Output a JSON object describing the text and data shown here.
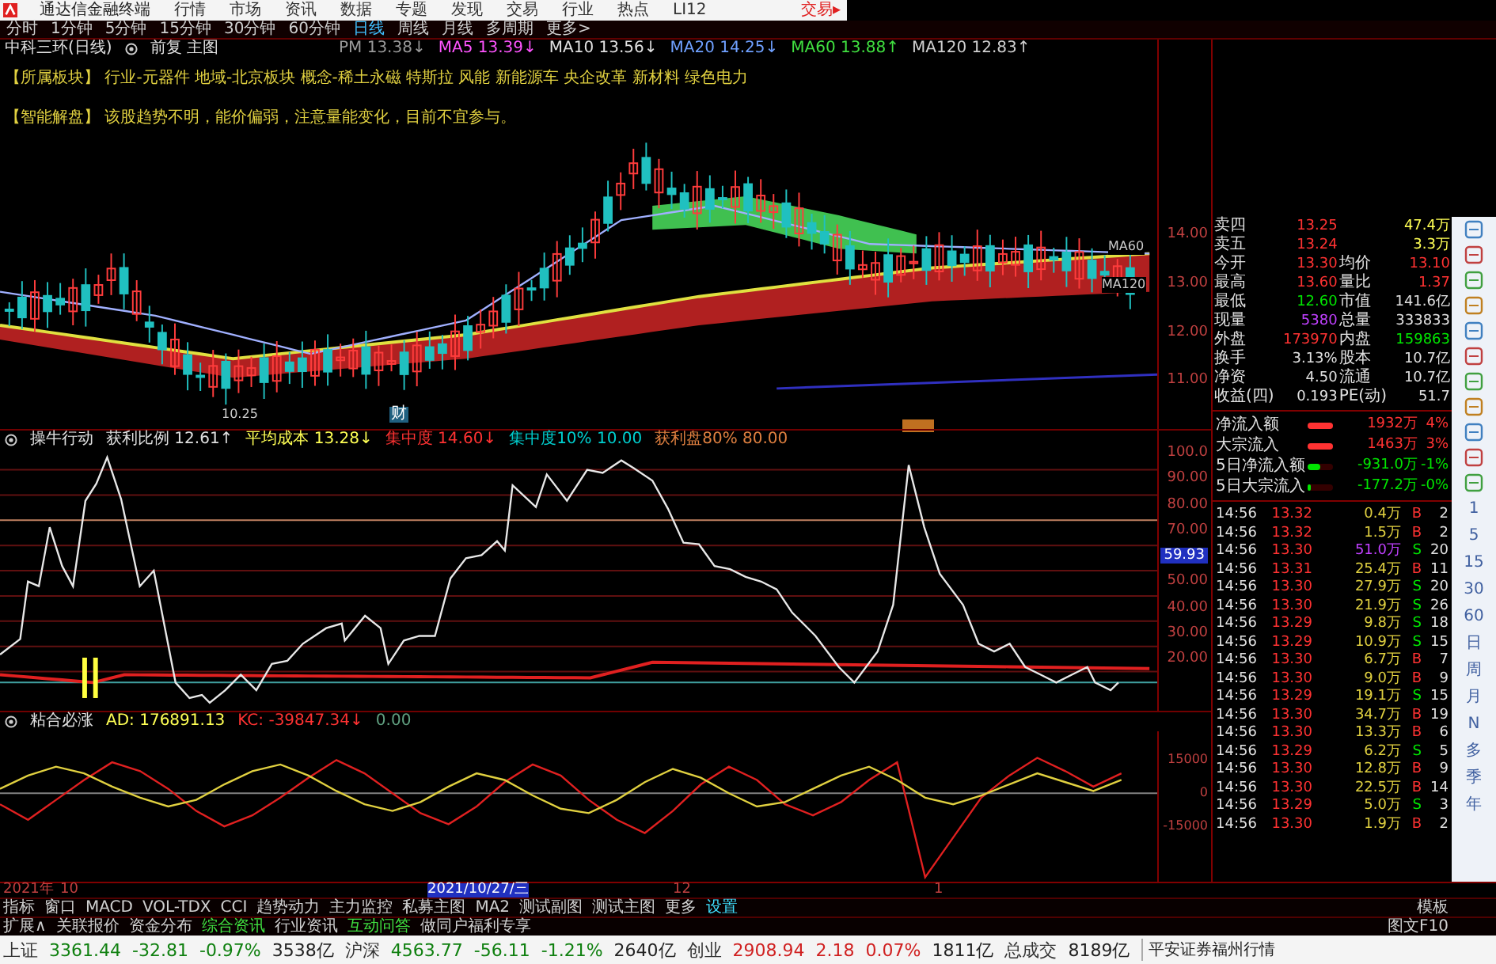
{
  "menu": {
    "app_title": "通达信金融终端",
    "items": [
      "行情",
      "市场",
      "资讯",
      "数据",
      "专题",
      "发现",
      "交易",
      "行业",
      "热点",
      "LI12"
    ],
    "trade_button": "交易▸"
  },
  "periods": [
    {
      "label": "分时",
      "selected": false
    },
    {
      "label": "1分钟",
      "selected": false
    },
    {
      "label": "5分钟",
      "selected": false
    },
    {
      "label": "15分钟",
      "selected": false
    },
    {
      "label": "30分钟",
      "selected": false
    },
    {
      "label": "60分钟",
      "selected": false
    },
    {
      "label": "日线",
      "selected": true
    },
    {
      "label": "周线",
      "selected": false
    },
    {
      "label": "月线",
      "selected": false
    },
    {
      "label": "多周期",
      "selected": false
    },
    {
      "label": "更多>",
      "selected": false
    }
  ],
  "main_chart": {
    "stock_name": "中科三环(日线)",
    "mode": "前复 主图",
    "indicators": [
      {
        "text": "PM 13.38↓",
        "color": "#9a9a9a"
      },
      {
        "text": "MA5 13.39↓",
        "color": "#ff54ff"
      },
      {
        "text": "MA10 13.56↓",
        "color": "#e0e0e0"
      },
      {
        "text": "MA20 14.25↓",
        "color": "#6fa0ff"
      },
      {
        "text": "MA60 13.88↑",
        "color": "#40e040"
      },
      {
        "text": "MA120 12.83↑",
        "color": "#d0d0d0"
      }
    ],
    "sector": {
      "label": "【所属板块】",
      "text": "行业-元器件  地域-北京板块  概念-稀土永磁 特斯拉 风能 新能源车 央企改革 新材料 绿色电力"
    },
    "analysis": {
      "label": "【智能解盘】",
      "text": "该股趋势不明，能价偏弱，注意量能变化，目前不宜参与。"
    },
    "line_labels": [
      "MA60",
      "MA120"
    ],
    "low_label": "10.25",
    "marker": "财",
    "y_labels": [
      "14.00",
      "13.00",
      "12.00",
      "11.00"
    ]
  },
  "chip_indicator": {
    "name": "操牛行动",
    "items": [
      {
        "text": "获利比例 12.61↑",
        "color": "#e0e0e0"
      },
      {
        "text": "平均成本 13.28↓",
        "color": "#ffff54"
      },
      {
        "text": "集中度 14.60↓",
        "color": "#ff3232"
      },
      {
        "text": "集中度10% 10.00",
        "color": "#00d0d0"
      },
      {
        "text": "获利盘80% 80.00",
        "color": "#e08040"
      }
    ],
    "y_labels": [
      {
        "text": "100.0",
        "current": false
      },
      {
        "text": "90.00",
        "current": false
      },
      {
        "text": "80.00",
        "current": false
      },
      {
        "text": "70.00",
        "current": false
      },
      {
        "text": "59.93",
        "current": true
      },
      {
        "text": "50.00",
        "current": false
      },
      {
        "text": "40.00",
        "current": false
      },
      {
        "text": "30.00",
        "current": false
      },
      {
        "text": "20.00",
        "current": false
      }
    ]
  },
  "oscillator": {
    "name": "粘合必涨",
    "items": [
      {
        "text": "AD: 176891.13",
        "color": "#ffff54"
      },
      {
        "text": "KC: -39847.34↓",
        "color": "#ff3232"
      },
      {
        "text": "0.00",
        "color": "#60a080"
      }
    ],
    "chart_data": {
      "type": "line",
      "ylim": [
        -40000,
        28000
      ],
      "yticks": [
        15000,
        0,
        -15000
      ],
      "series": [
        {
          "color": "#e0d040",
          "values": [
            2000,
            8000,
            12000,
            9000,
            3000,
            -2000,
            -6000,
            -3000,
            4000,
            10000,
            13000,
            8000,
            1000,
            -5000,
            -8000,
            -4000,
            3000,
            9000,
            6000,
            -1000,
            -7000,
            -9000,
            -3000,
            5000,
            11000,
            7000,
            0,
            -6000,
            -4000,
            2000,
            8000,
            12000,
            6000,
            -2000,
            -5000,
            -1000,
            4000,
            9000,
            5000,
            1000,
            6000
          ]
        },
        {
          "color": "#e02020",
          "values": [
            -5000,
            -12000,
            -3000,
            6000,
            14000,
            10000,
            2000,
            -8000,
            -15000,
            -10000,
            -2000,
            7000,
            15000,
            9000,
            0,
            -9000,
            -14000,
            -6000,
            5000,
            13000,
            8000,
            -3000,
            -12000,
            -18000,
            -8000,
            4000,
            12000,
            6000,
            -5000,
            -10000,
            -4000,
            6000,
            14000,
            -38000,
            -20000,
            -2000,
            8000,
            16000,
            10000,
            3000,
            9000
          ]
        }
      ]
    }
  },
  "date_axis": [
    {
      "label": "2021年",
      "selected": false
    },
    {
      "label": "10",
      "selected": false
    },
    {
      "label": "2021/10/27/三",
      "selected": true
    },
    {
      "label": "12",
      "selected": false
    },
    {
      "label": "1",
      "selected": false
    }
  ],
  "indicator_tabs": [
    {
      "label": "指标",
      "selected": false
    },
    {
      "label": "窗口",
      "selected": false
    },
    {
      "label": "MACD",
      "selected": false
    },
    {
      "label": "VOL-TDX",
      "selected": false
    },
    {
      "label": "CCI",
      "selected": false
    },
    {
      "label": "趋势动力",
      "selected": false
    },
    {
      "label": "主力监控",
      "selected": false
    },
    {
      "label": "私募主图",
      "selected": false
    },
    {
      "label": "MA2",
      "selected": false
    },
    {
      "label": "测试副图",
      "selected": false
    },
    {
      "label": "测试主图",
      "selected": false
    },
    {
      "label": "更多",
      "selected": false
    },
    {
      "label": "设置",
      "selected": true
    }
  ],
  "template_button": "模板",
  "extension_tabs": [
    {
      "label": "扩展∧",
      "selected": false
    },
    {
      "label": "关联报价",
      "selected": false
    },
    {
      "label": "资金分布",
      "selected": false
    },
    {
      "label": "综合资讯",
      "selected": true
    },
    {
      "label": "行业资讯",
      "selected": false
    },
    {
      "label": "互动问答",
      "selected": true
    },
    {
      "label": "做同户福利专享",
      "selected": false
    }
  ],
  "f10_button": "图文F10",
  "quote": [
    {
      "cells": [
        {
          "label": "卖四",
          "value": "13.25",
          "color": "#ff3232"
        },
        {
          "value": "47.4万",
          "color": "#ffff54"
        }
      ]
    },
    {
      "cells": [
        {
          "label": "卖五",
          "value": "13.24",
          "color": "#ff3232"
        },
        {
          "value": "3.3万",
          "color": "#ffff54"
        }
      ]
    },
    {
      "cells": [
        {
          "label": "今开",
          "value": "13.30",
          "color": "#ff3232"
        },
        {
          "label": "均价",
          "value": "13.10",
          "color": "#ff3232"
        }
      ]
    },
    {
      "cells": [
        {
          "label": "最高",
          "value": "13.60",
          "color": "#ff3232"
        },
        {
          "label": "量比",
          "value": "1.37",
          "color": "#ff3232"
        }
      ]
    },
    {
      "cells": [
        {
          "label": "最低",
          "value": "12.60",
          "color": "#00e600"
        },
        {
          "label": "市值",
          "value": "141.6亿",
          "color": "#e0e0e0"
        }
      ]
    },
    {
      "cells": [
        {
          "label": "现量",
          "value": "5380",
          "color": "#c040ff"
        },
        {
          "label": "总量",
          "value": "333833",
          "color": "#e0e0e0"
        }
      ]
    },
    {
      "cells": [
        {
          "label": "外盘",
          "value": "173970",
          "color": "#ff3232"
        },
        {
          "label": "内盘",
          "value": "159863",
          "color": "#00e600"
        }
      ]
    },
    {
      "cells": [
        {
          "label": "换手",
          "value": "3.13%",
          "color": "#e0e0e0"
        },
        {
          "label": "股本",
          "value": "10.7亿",
          "color": "#e0e0e0"
        }
      ]
    },
    {
      "cells": [
        {
          "label": "净资",
          "value": "4.50",
          "color": "#e0e0e0"
        },
        {
          "label": "流通",
          "value": "10.7亿",
          "color": "#e0e0e0"
        }
      ]
    },
    {
      "cells": [
        {
          "label": "收益(四)",
          "value": "0.193",
          "color": "#e0e0e0"
        },
        {
          "label": "PE(动)",
          "value": "51.7",
          "color": "#e0e0e0"
        }
      ]
    }
  ],
  "fund_flow": [
    {
      "label": "净流入额",
      "level": 1,
      "color": "#ff3232",
      "amount": "1932万",
      "percent": "4%"
    },
    {
      "label": "大宗流入",
      "level": 1,
      "color": "#ff3232",
      "amount": "1463万",
      "percent": "3%"
    },
    {
      "label": "5日净流入额",
      "level": 0.5,
      "color": "#00e600",
      "amount": "-931.0万",
      "percent": "-1%"
    },
    {
      "label": "5日大宗流入",
      "level": 0.1,
      "color": "#00e600",
      "amount": "-177.2万",
      "percent": "-0%"
    }
  ],
  "ticks": [
    {
      "time": "14:56",
      "price": "13.32",
      "volume": "0.4万",
      "large": false,
      "side": "B",
      "buy": true,
      "count": "2"
    },
    {
      "time": "14:56",
      "price": "13.32",
      "volume": "1.5万",
      "large": false,
      "side": "B",
      "buy": true,
      "count": "2"
    },
    {
      "time": "14:56",
      "price": "13.30",
      "volume": "51.0万",
      "large": true,
      "side": "S",
      "buy": false,
      "count": "20"
    },
    {
      "time": "14:56",
      "price": "13.31",
      "volume": "25.4万",
      "large": false,
      "side": "B",
      "buy": true,
      "count": "11"
    },
    {
      "time": "14:56",
      "price": "13.30",
      "volume": "27.9万",
      "large": false,
      "side": "S",
      "buy": false,
      "count": "20"
    },
    {
      "time": "14:56",
      "price": "13.30",
      "volume": "21.9万",
      "large": false,
      "side": "S",
      "buy": false,
      "count": "26"
    },
    {
      "time": "14:56",
      "price": "13.29",
      "volume": "9.8万",
      "large": false,
      "side": "S",
      "buy": false,
      "count": "18"
    },
    {
      "time": "14:56",
      "price": "13.29",
      "volume": "10.9万",
      "large": false,
      "side": "S",
      "buy": false,
      "count": "15"
    },
    {
      "time": "14:56",
      "price": "13.30",
      "volume": "6.7万",
      "large": false,
      "side": "B",
      "buy": true,
      "count": "7"
    },
    {
      "time": "14:56",
      "price": "13.30",
      "volume": "9.0万",
      "large": false,
      "side": "B",
      "buy": true,
      "count": "9"
    },
    {
      "time": "14:56",
      "price": "13.29",
      "volume": "19.1万",
      "large": false,
      "side": "S",
      "buy": false,
      "count": "15"
    },
    {
      "time": "14:56",
      "price": "13.30",
      "volume": "34.7万",
      "large": false,
      "side": "B",
      "buy": true,
      "count": "19"
    },
    {
      "time": "14:56",
      "price": "13.30",
      "volume": "13.3万",
      "large": false,
      "side": "B",
      "buy": true,
      "count": "6"
    },
    {
      "time": "14:56",
      "price": "13.29",
      "volume": "6.2万",
      "large": false,
      "side": "S",
      "buy": false,
      "count": "5"
    },
    {
      "time": "14:56",
      "price": "13.30",
      "volume": "12.8万",
      "large": false,
      "side": "B",
      "buy": true,
      "count": "9"
    },
    {
      "time": "14:56",
      "price": "13.30",
      "volume": "22.5万",
      "large": false,
      "side": "B",
      "buy": true,
      "count": "14"
    },
    {
      "time": "14:56",
      "price": "13.29",
      "volume": "5.0万",
      "large": false,
      "side": "S",
      "buy": false,
      "count": "3"
    },
    {
      "time": "14:56",
      "price": "13.30",
      "volume": "1.9万",
      "large": false,
      "side": "B",
      "buy": true,
      "count": "2"
    }
  ],
  "period_shortcuts": [
    "1",
    "5",
    "15",
    "30",
    "60",
    "日",
    "周",
    "月",
    "N",
    "多",
    "季",
    "年"
  ],
  "status_bar": [
    {
      "name": "上证",
      "value": "3361.44",
      "change": "-32.81",
      "percent": "-0.97%",
      "amount": "3538亿",
      "up": false
    },
    {
      "name": "沪深",
      "value": "4563.77",
      "change": "-56.11",
      "percent": "-1.21%",
      "amount": "2640亿",
      "up": false
    },
    {
      "name": "创业",
      "value": "2908.94",
      "change": "2.18",
      "percent": "0.07%",
      "amount": "1811亿",
      "up": true
    }
  ],
  "total_turnover": {
    "label": "总成交",
    "amount": "8189亿"
  },
  "feed": "平安证券福州行情"
}
